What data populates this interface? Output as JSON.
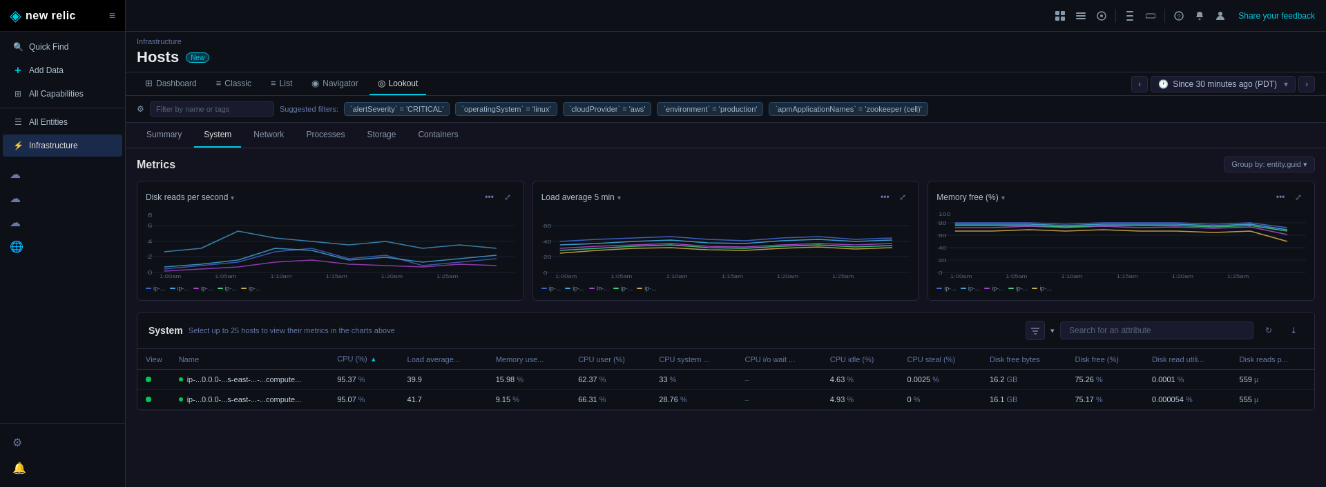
{
  "app": {
    "logo": "new relic",
    "logo_icon": "◈"
  },
  "sidebar": {
    "items": [
      {
        "id": "quick-find",
        "label": "Quick Find",
        "icon": "🔍"
      },
      {
        "id": "add-data",
        "label": "Add Data",
        "icon": "+"
      },
      {
        "id": "all-capabilities",
        "label": "All Capabilities",
        "icon": "⊞"
      },
      {
        "id": "all-entities",
        "label": "All Entities",
        "icon": "☰"
      },
      {
        "id": "infrastructure",
        "label": "Infrastructure",
        "icon": "⚡",
        "active": true
      }
    ],
    "cloud_icons": [
      "☁",
      "☁",
      "☁",
      "☁"
    ],
    "bottom_icons": [
      "⚙",
      "🔔"
    ]
  },
  "topbar": {
    "share_feedback": "Share your feedback"
  },
  "page": {
    "breadcrumb": "Infrastructure",
    "title": "Hosts",
    "badge": "New"
  },
  "view_tabs": [
    {
      "id": "dashboard",
      "label": "Dashboard",
      "icon": "⊞",
      "active": false
    },
    {
      "id": "classic",
      "label": "Classic",
      "icon": "≡",
      "active": false
    },
    {
      "id": "list",
      "label": "List",
      "icon": "≡",
      "active": false
    },
    {
      "id": "navigator",
      "label": "Navigator",
      "icon": "◉",
      "active": false
    },
    {
      "id": "lookout",
      "label": "Lookout",
      "icon": "◎",
      "active": false
    }
  ],
  "time": {
    "label": "Since 30 minutes ago (PDT)",
    "chevron": "▾"
  },
  "filters": {
    "placeholder": "Filter by name or tags",
    "suggested_label": "Suggested filters:",
    "chips": [
      "`alertSeverity` = 'CRITICAL'",
      "`operatingSystem` = 'linux'",
      "`cloudProvider` = 'aws'",
      "`environment` = 'production'",
      "`apmApplicationNames` = 'zookeeper (cell)'"
    ]
  },
  "section_tabs": [
    {
      "id": "summary",
      "label": "Summary",
      "active": false
    },
    {
      "id": "system",
      "label": "System",
      "active": true
    },
    {
      "id": "network",
      "label": "Network",
      "active": false
    },
    {
      "id": "processes",
      "label": "Processes",
      "active": false
    },
    {
      "id": "storage",
      "label": "Storage",
      "active": false
    },
    {
      "id": "containers",
      "label": "Containers",
      "active": false
    }
  ],
  "metrics": {
    "title": "Metrics",
    "group_by": "Group by: entity.guid ▾",
    "charts": [
      {
        "id": "disk-reads",
        "title": "Disk reads per second",
        "y_values": [
          0,
          2,
          4,
          6,
          8
        ],
        "x_labels": [
          "1:00am",
          "1:05am",
          "1:10am",
          "1:15am",
          "1:20am",
          "1:25am"
        ],
        "legend": [
          {
            "color": "#4466cc",
            "label": "ip-..."
          },
          {
            "color": "#44aadd",
            "label": "ip-..."
          },
          {
            "color": "#6644bb",
            "label": "ip-..."
          },
          {
            "color": "#44cc88",
            "label": "ip-..."
          },
          {
            "color": "#ccaa44",
            "label": "ip-..."
          }
        ]
      },
      {
        "id": "load-average",
        "title": "Load average 5 min",
        "y_values": [
          0,
          20,
          40,
          60
        ],
        "x_labels": [
          "1:00am",
          "1:05am",
          "1:10am",
          "1:15am",
          "1:20am",
          "1:25am"
        ],
        "legend": [
          {
            "color": "#4466cc",
            "label": "ip-..."
          },
          {
            "color": "#44aadd",
            "label": "ip-..."
          },
          {
            "color": "#6644bb",
            "label": "In-..."
          },
          {
            "color": "#44cc88",
            "label": "ip-..."
          },
          {
            "color": "#ccaa44",
            "label": "ip-..."
          }
        ]
      },
      {
        "id": "memory-free",
        "title": "Memory free (%)",
        "y_values": [
          0,
          20,
          40,
          60,
          80,
          100
        ],
        "x_labels": [
          "1:00am",
          "1:05am",
          "1:10am",
          "1:15am",
          "1:20am",
          "1:25am"
        ],
        "legend": [
          {
            "color": "#4466cc",
            "label": "ip-..."
          },
          {
            "color": "#44aadd",
            "label": "ip-..."
          },
          {
            "color": "#6644bb",
            "label": "ip-..."
          },
          {
            "color": "#44cc88",
            "label": "ip-..."
          },
          {
            "color": "#ccaa44",
            "label": "ip-..."
          }
        ]
      }
    ]
  },
  "system_table": {
    "title": "System",
    "subtitle": "Select up to 25 hosts to view their metrics in the charts above",
    "search_placeholder": "Search for an attribute",
    "columns": [
      {
        "id": "view",
        "label": "View"
      },
      {
        "id": "name",
        "label": "Name"
      },
      {
        "id": "cpu-pct",
        "label": "CPU (%)",
        "sorted": true,
        "sort_dir": "▴"
      },
      {
        "id": "load-avg",
        "label": "Load average..."
      },
      {
        "id": "memory-use",
        "label": "Memory use..."
      },
      {
        "id": "cpu-user",
        "label": "CPU user (%)"
      },
      {
        "id": "cpu-system",
        "label": "CPU system ..."
      },
      {
        "id": "cpu-iowait",
        "label": "CPU i/o wait ..."
      },
      {
        "id": "cpu-idle",
        "label": "CPU idle (%)"
      },
      {
        "id": "cpu-steal",
        "label": "CPU steal (%)"
      },
      {
        "id": "disk-free-bytes",
        "label": "Disk free bytes"
      },
      {
        "id": "disk-free-pct",
        "label": "Disk free (%)"
      },
      {
        "id": "disk-read-util",
        "label": "Disk read utili..."
      },
      {
        "id": "disk-reads-ps",
        "label": "Disk reads p..."
      }
    ],
    "rows": [
      {
        "status": "green",
        "name": "ip-...0.0.0-...s-east-...-...compute...",
        "cpu_pct": "95.37",
        "cpu_pct_unit": "%",
        "load_avg": "39.9",
        "memory_use": "15.98",
        "memory_use_unit": "%",
        "cpu_user": "62.37",
        "cpu_user_unit": "%",
        "cpu_system": "33",
        "cpu_system_unit": "%",
        "cpu_iowait": "–",
        "cpu_idle": "4.63",
        "cpu_idle_unit": "%",
        "cpu_steal": "0.0025",
        "cpu_steal_unit": "%",
        "disk_free_bytes": "16.2",
        "disk_free_bytes_unit": "GB",
        "disk_free_pct": "75.26",
        "disk_free_pct_unit": "%",
        "disk_read_util": "0.0001",
        "disk_read_util_unit": "%",
        "disk_reads_ps": "559",
        "disk_reads_ps_unit": "μ"
      },
      {
        "status": "green",
        "name": "ip-...0.0.0-...s-east-...-...compute...",
        "cpu_pct": "95.07",
        "cpu_pct_unit": "%",
        "load_avg": "41.7",
        "memory_use": "9.15",
        "memory_use_unit": "%",
        "cpu_user": "66.31",
        "cpu_user_unit": "%",
        "cpu_system": "28.76",
        "cpu_system_unit": "%",
        "cpu_iowait": "–",
        "cpu_idle": "4.93",
        "cpu_idle_unit": "%",
        "cpu_steal": "0",
        "cpu_steal_unit": "%",
        "disk_free_bytes": "16.1",
        "disk_free_bytes_unit": "GB",
        "disk_free_pct": "75.17",
        "disk_free_pct_unit": "%",
        "disk_read_util": "0.000054",
        "disk_read_util_unit": "%",
        "disk_reads_ps": "555",
        "disk_reads_ps_unit": "μ"
      }
    ]
  }
}
